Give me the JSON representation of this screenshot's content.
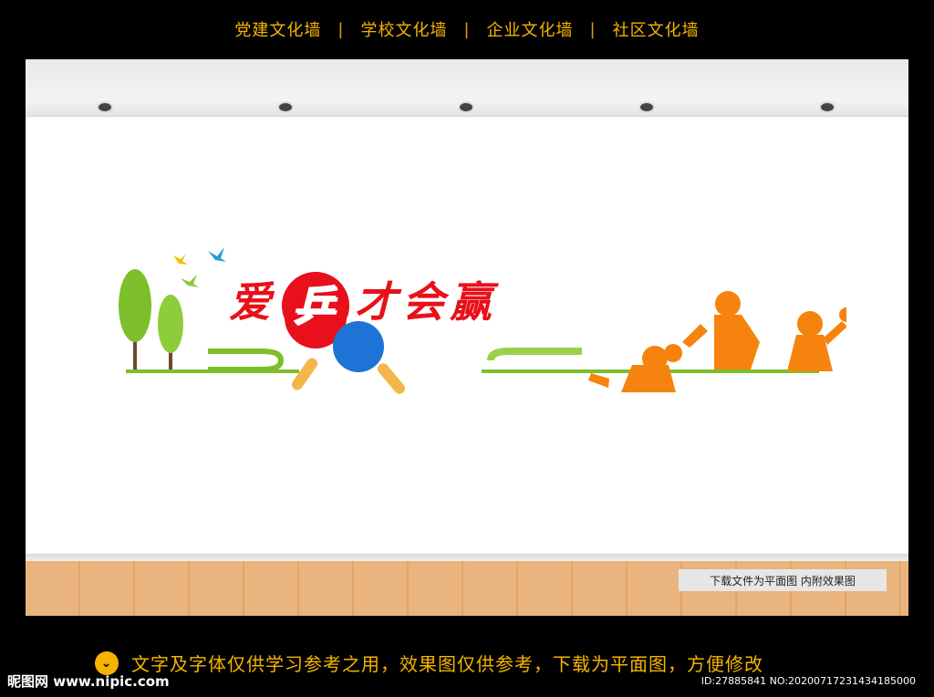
{
  "top_nav": {
    "items": [
      "党建文化墙",
      "学校文化墙",
      "企业文化墙",
      "社区文化墙"
    ],
    "separator": "|"
  },
  "mural": {
    "title_char_1": "爱",
    "title_char_ball": "乒",
    "title_rest": "才会赢",
    "title_color": "#e8101a",
    "silhouette_color": "#f7830f",
    "tree_color": "#7cbf2a",
    "paddle_colors": [
      "#e8101a",
      "#1e73d6"
    ],
    "paddle_handle_color": "#f4b64a"
  },
  "floor_note": "下载文件为平面图  内附效果图",
  "footer": {
    "notice": "文字及字体仅供学习参考之用，效果图仅供参考，下载为平面图，方便修改",
    "brand": "昵图网 www.nipic.com",
    "image_id": "ID:27885841 NO:20200717231434185000",
    "accent": "#f4b400"
  }
}
